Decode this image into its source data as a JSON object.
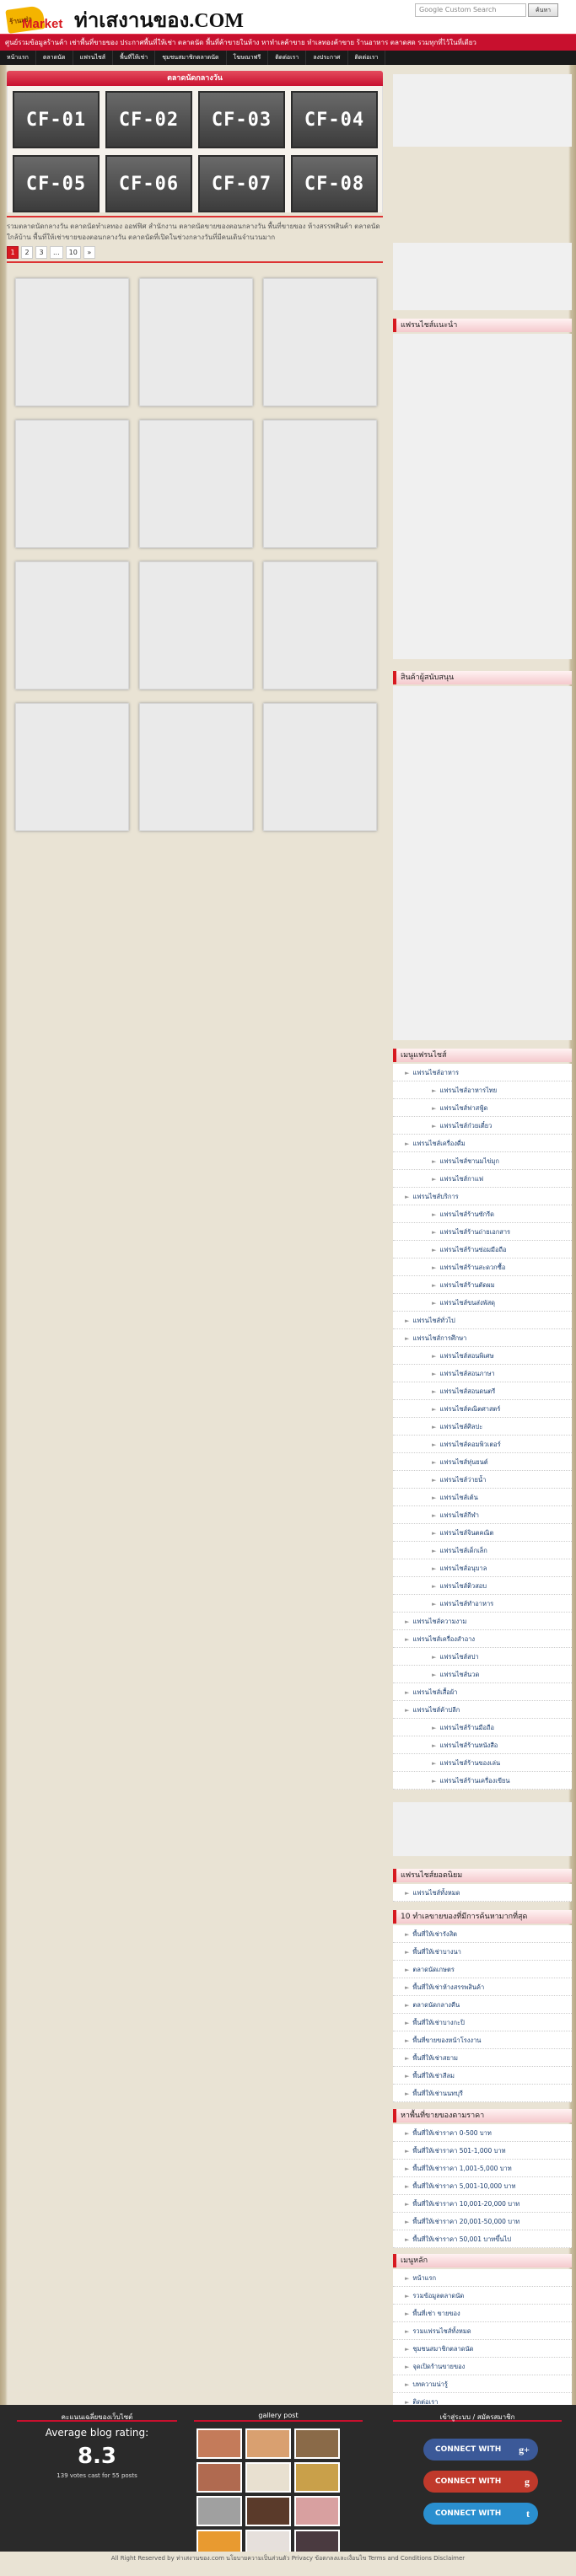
{
  "header": {
    "logo_badge": "ร้านเช่า",
    "logo_market": "Market",
    "site_title": "ท่าเสงานของ.COM",
    "search_placeholder": "Google Custom Search",
    "search_button": "ค้นหา"
  },
  "tagline": "ศูนย์รวมข้อมูลร้านค้า เช่าพื้นที่ขายของ ประกาศพื้นที่ให้เช่า ตลาดนัด พื้นที่ค้าขายในห้าง หาทำเลค้าขาย ทำเลทองค้าขาย ร้านอาหาร ตลาดสด รวมทุกที่ไว้ในที่เดียว",
  "nav": [
    "หน้าแรก",
    "ตลาดนัด",
    "แฟรนไชส์",
    "พื้นที่ให้เช่า",
    "ชุมชนสมาชิกตลาดนัด",
    "โฆษณาฟรี",
    "ติดต่อเรา",
    "ลงประกาศ",
    "ติดต่อเรา"
  ],
  "main": {
    "panel_title": "ตลาดนัดกลางวัน",
    "codes": [
      "CF-01",
      "CF-02",
      "CF-03",
      "CF-04",
      "CF-05",
      "CF-06",
      "CF-07",
      "CF-08"
    ],
    "intro": "รวมตลาดนัดกลางวัน ตลาดนัดทำเลทอง ออฟฟิศ สำนักงาน ตลาดนัดขายของตอนกลางวัน พื้นที่ขายของ ห้างสรรพสินค้า ตลาดนัดใกล้บ้าน พื้นที่ให้เช่าขายของตอนกลางวัน ตลาดนัดที่เปิดในช่วงกลางวันที่มีคนเดินจำนวนมาก",
    "pager": [
      "1",
      "2",
      "3",
      "...",
      "10",
      "»"
    ]
  },
  "sidebar": {
    "ad_head": "แฟรนไชส์แนะนำ",
    "partners_head": "สินค้าผู้สนับสนุน",
    "menu_head": "เมนูแฟรนไชส์",
    "menu": [
      {
        "label": "แฟรนไชส์อาหาร",
        "top": true
      },
      {
        "label": "แฟรนไชส์อาหารไทย",
        "top": false
      },
      {
        "label": "แฟรนไชส์ฟาสฟู้ด",
        "top": false
      },
      {
        "label": "แฟรนไชส์ก๋วยเตี๋ยว",
        "top": false
      },
      {
        "label": "แฟรนไชส์เครื่องดื่ม",
        "top": true
      },
      {
        "label": "แฟรนไชส์ชานมไข่มุก",
        "top": false
      },
      {
        "label": "แฟรนไชส์กาแฟ",
        "top": false
      },
      {
        "label": "แฟรนไชส์บริการ",
        "top": true
      },
      {
        "label": "แฟรนไชส์ร้านซักรีด",
        "top": false
      },
      {
        "label": "แฟรนไชส์ร้านถ่ายเอกสาร",
        "top": false
      },
      {
        "label": "แฟรนไชส์ร้านซ่อมมือถือ",
        "top": false
      },
      {
        "label": "แฟรนไชส์ร้านสะดวกซื้อ",
        "top": false
      },
      {
        "label": "แฟรนไชส์ร้านตัดผม",
        "top": false
      },
      {
        "label": "แฟรนไชส์ขนส่งพัสดุ",
        "top": false
      },
      {
        "label": "แฟรนไชส์ทั่วไป",
        "top": true
      },
      {
        "label": "แฟรนไชส์การศึกษา",
        "top": true
      },
      {
        "label": "แฟรนไชส์สอนพิเศษ",
        "top": false
      },
      {
        "label": "แฟรนไชส์สอนภาษา",
        "top": false
      },
      {
        "label": "แฟรนไชส์สอนดนตรี",
        "top": false
      },
      {
        "label": "แฟรนไชส์คณิตศาสตร์",
        "top": false
      },
      {
        "label": "แฟรนไชส์ศิลปะ",
        "top": false
      },
      {
        "label": "แฟรนไชส์คอมพิวเตอร์",
        "top": false
      },
      {
        "label": "แฟรนไชส์หุ่นยนต์",
        "top": false
      },
      {
        "label": "แฟรนไชส์ว่ายน้ำ",
        "top": false
      },
      {
        "label": "แฟรนไชส์เต้น",
        "top": false
      },
      {
        "label": "แฟรนไชส์กีฬา",
        "top": false
      },
      {
        "label": "แฟรนไชส์จินตคณิต",
        "top": false
      },
      {
        "label": "แฟรนไชส์เด็กเล็ก",
        "top": false
      },
      {
        "label": "แฟรนไชส์อนุบาล",
        "top": false
      },
      {
        "label": "แฟรนไชส์ติวสอบ",
        "top": false
      },
      {
        "label": "แฟรนไชส์ทำอาหาร",
        "top": false
      },
      {
        "label": "แฟรนไชส์ความงาม",
        "top": true
      },
      {
        "label": "แฟรนไชส์เครื่องสำอาง",
        "top": true
      },
      {
        "label": "แฟรนไชส์สปา",
        "top": false
      },
      {
        "label": "แฟรนไชส์นวด",
        "top": false
      },
      {
        "label": "แฟรนไชส์เสื้อผ้า",
        "top": true
      },
      {
        "label": "แฟรนไชส์ค้าปลีก",
        "top": true
      },
      {
        "label": "แฟรนไชส์ร้านมือถือ",
        "top": false
      },
      {
        "label": "แฟรนไชส์ร้านหนังสือ",
        "top": false
      },
      {
        "label": "แฟรนไชส์ร้านของเล่น",
        "top": false
      },
      {
        "label": "แฟรนไชส์ร้านเครื่องเขียน",
        "top": false
      }
    ],
    "franchise_head": "แฟรนไชส์ยอดนิยม",
    "franchise_list": [
      "แฟรนไชส์ทั้งหมด"
    ],
    "top10_head": "10 ทำเลขายของที่มีการค้นหามากที่สุด",
    "top10": [
      "พื้นที่ให้เช่ารังสิต",
      "พื้นที่ให้เช่าบางนา",
      "ตลาดนัดเกษตร",
      "พื้นที่ให้เช่าห้างสรรพสินค้า",
      "ตลาดนัดกลางคืน",
      "พื้นที่ให้เช่าบางกะปิ",
      "พื้นที่ขายของหน้าโรงงาน",
      "พื้นที่ให้เช่าสยาม",
      "พื้นที่ให้เช่าสีลม",
      "พื้นที่ให้เช่านนทบุรี"
    ],
    "price_head": "หาพื้นที่ขายของตามราคา",
    "prices": [
      "พื้นที่ให้เช่าราคา 0-500 บาท",
      "พื้นที่ให้เช่าราคา 501-1,000 บาท",
      "พื้นที่ให้เช่าราคา 1,001-5,000 บาท",
      "พื้นที่ให้เช่าราคา 5,001-10,000 บาท",
      "พื้นที่ให้เช่าราคา 10,001-20,000 บาท",
      "พื้นที่ให้เช่าราคา 20,001-50,000 บาท",
      "พื้นที่ให้เช่าราคา 50,001 บาทขึ้นไป"
    ],
    "main_menu_head": "เมนูหลัก",
    "main_menu": [
      "หน้าแรก",
      "รวมข้อมูลตลาดนัด",
      "พื้นที่เช่า ขายของ",
      "รวมแฟรนไชส์ทั้งหมด",
      "ชุมชนสมาชิกตลาดนัด",
      "จุดเปิดร้านขายของ",
      "บทความน่ารู้",
      "ติดต่อเรา"
    ]
  },
  "footer": {
    "rating_head": "คะแนนเฉลี่ยของเว็บไซต์",
    "gallery_head": "gallery post",
    "login_head": "เข้าสู่ระบบ / สมัครสมาชิก",
    "rating_title": "Average blog rating:",
    "rating_value": "8.3",
    "votes": "139 votes cast for 55 posts",
    "connect_label": "CONNECT WITH",
    "connect_icons": [
      "g+",
      "g",
      "t"
    ],
    "connect_colors": [
      "#3b5998",
      "#c0392b",
      "#2a8fcf"
    ],
    "photo_colors": [
      "#c47b5a",
      "#d9a070",
      "#8a6a48",
      "#b06a50",
      "#e8e0d0",
      "#c9a04a",
      "#a0a0a0",
      "#5a3a2a",
      "#d8a0a0",
      "#e89a30",
      "#e6e0dc",
      "#4a3a40"
    ],
    "copyright": "All Right Reserved by ท่าเสงานของ.com นโยบายความเป็นส่วนตัว Privacy ข้อตกลงและเงื่อนไข Terms and Conditions Disclaimer"
  }
}
